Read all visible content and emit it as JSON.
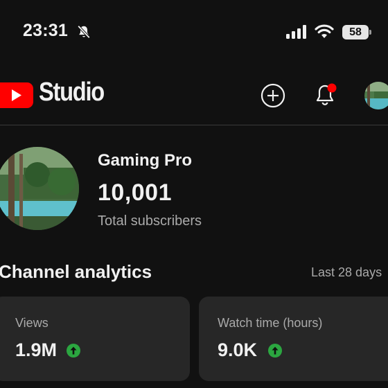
{
  "status_bar": {
    "time": "23:31",
    "battery": "58",
    "icons": [
      "bell-slash-icon",
      "cellular-signal-icon",
      "wifi-icon",
      "battery-icon"
    ]
  },
  "header": {
    "logo": "youtube-logo",
    "app_name": "Studio",
    "icons": [
      "plus-circle-icon",
      "bell-icon",
      "avatar"
    ],
    "notification_dot_color": "#ff0000"
  },
  "channel": {
    "name": "Gaming Pro",
    "subscribers": "10,001",
    "subscribers_label": "Total subscribers"
  },
  "analytics": {
    "title": "Channel analytics",
    "range": "Last 28 days",
    "cards": [
      {
        "label": "Views",
        "value": "1.9M",
        "trend": "up"
      },
      {
        "label": "Watch time (hours)",
        "value": "9.0K",
        "trend": "up"
      }
    ],
    "trend_color": "#2ba640"
  },
  "colors": {
    "background": "#111111",
    "card": "#272727",
    "brand_red": "#ff0000",
    "text_secondary": "#aaaaaa"
  }
}
